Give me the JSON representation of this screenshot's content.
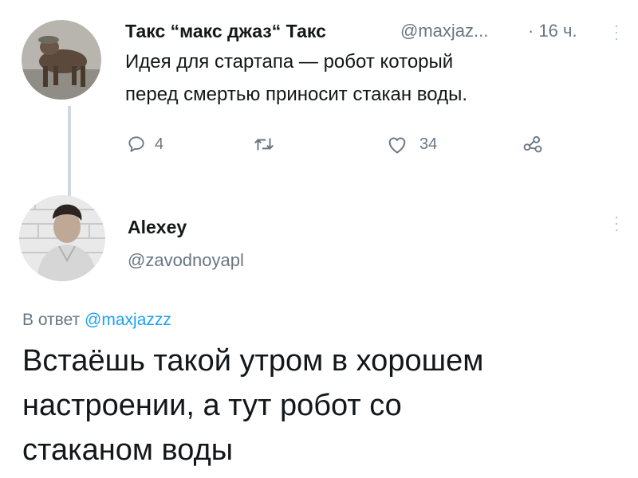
{
  "tweet": {
    "author_name": "Такс “макс джаз“ Такс",
    "handle": "@maxjaz...",
    "time": "· 16 ч.",
    "text_line1": "Идея для стартапа — робот который",
    "text_line2": "перед смертью приносит стакан воды.",
    "actions": {
      "reply_count": "4",
      "retweet_count": "",
      "like_count": "34"
    }
  },
  "reply": {
    "author_name": "Alexey",
    "handle": "@zavodnoyapl",
    "in_reply_prefix": "В ответ ",
    "in_reply_mention": "@maxjazzz",
    "text_line1": "Встаёшь такой утром в хорошем",
    "text_line2": "настроении, а тут робот со",
    "text_line3": "стаканом воды"
  },
  "colors": {
    "text": "#14171a",
    "muted": "#687684",
    "link": "#1da1f2",
    "divider": "#cfd9de"
  },
  "icons": [
    "reply-icon",
    "retweet-icon",
    "like-icon",
    "share-icon",
    "more-icon"
  ]
}
